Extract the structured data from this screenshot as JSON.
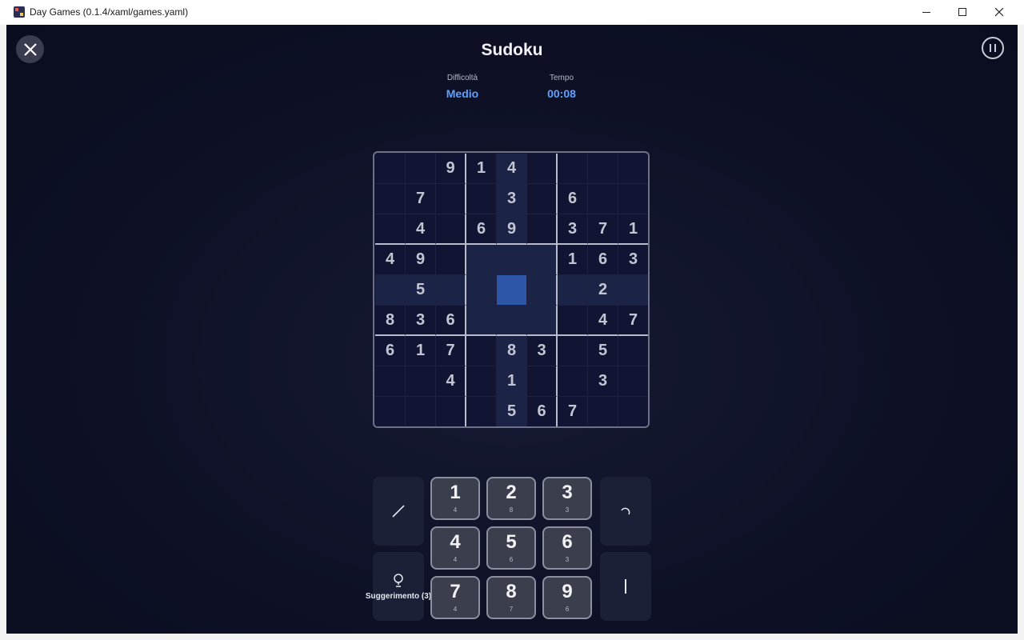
{
  "window": {
    "title": "Day Games (0.1.4/xaml/games.yaml)"
  },
  "header": {
    "title": "Sudoku",
    "difficulty_label": "Difficoltà",
    "difficulty_value": "Medio",
    "time_label": "Tempo",
    "time_value": "00:08"
  },
  "board": {
    "rows": [
      [
        "",
        "",
        "9",
        "1",
        "4",
        "",
        "",
        "",
        ""
      ],
      [
        "",
        "7",
        "",
        "",
        "3",
        "",
        "6",
        "",
        ""
      ],
      [
        "",
        "4",
        "",
        "6",
        "9",
        "",
        "3",
        "7",
        "1"
      ],
      [
        "4",
        "9",
        "",
        "",
        "",
        "",
        "1",
        "6",
        "3"
      ],
      [
        "",
        "5",
        "",
        "",
        "",
        "",
        "",
        "2",
        ""
      ],
      [
        "8",
        "3",
        "6",
        "",
        "",
        "",
        "",
        "4",
        "7"
      ],
      [
        "6",
        "1",
        "7",
        "",
        "8",
        "3",
        "",
        "5",
        ""
      ],
      [
        "",
        "",
        "4",
        "",
        "1",
        "",
        "",
        "3",
        ""
      ],
      [
        "",
        "",
        "",
        "",
        "5",
        "6",
        "7",
        "",
        ""
      ]
    ],
    "selected": {
      "row": 4,
      "col": 4
    }
  },
  "controls": {
    "hint_label": "Suggerimento (3)",
    "numbers": [
      {
        "n": "1",
        "count": "4"
      },
      {
        "n": "2",
        "count": "8"
      },
      {
        "n": "3",
        "count": "3"
      },
      {
        "n": "4",
        "count": "4"
      },
      {
        "n": "5",
        "count": "6"
      },
      {
        "n": "6",
        "count": "3"
      },
      {
        "n": "7",
        "count": "4"
      },
      {
        "n": "8",
        "count": "7"
      },
      {
        "n": "9",
        "count": "6"
      }
    ]
  },
  "colors": {
    "accent": "#5ea0ff",
    "selected_cell": "#2e56a8",
    "highlight_cell": "#1b2347",
    "background": "#0e1126"
  }
}
